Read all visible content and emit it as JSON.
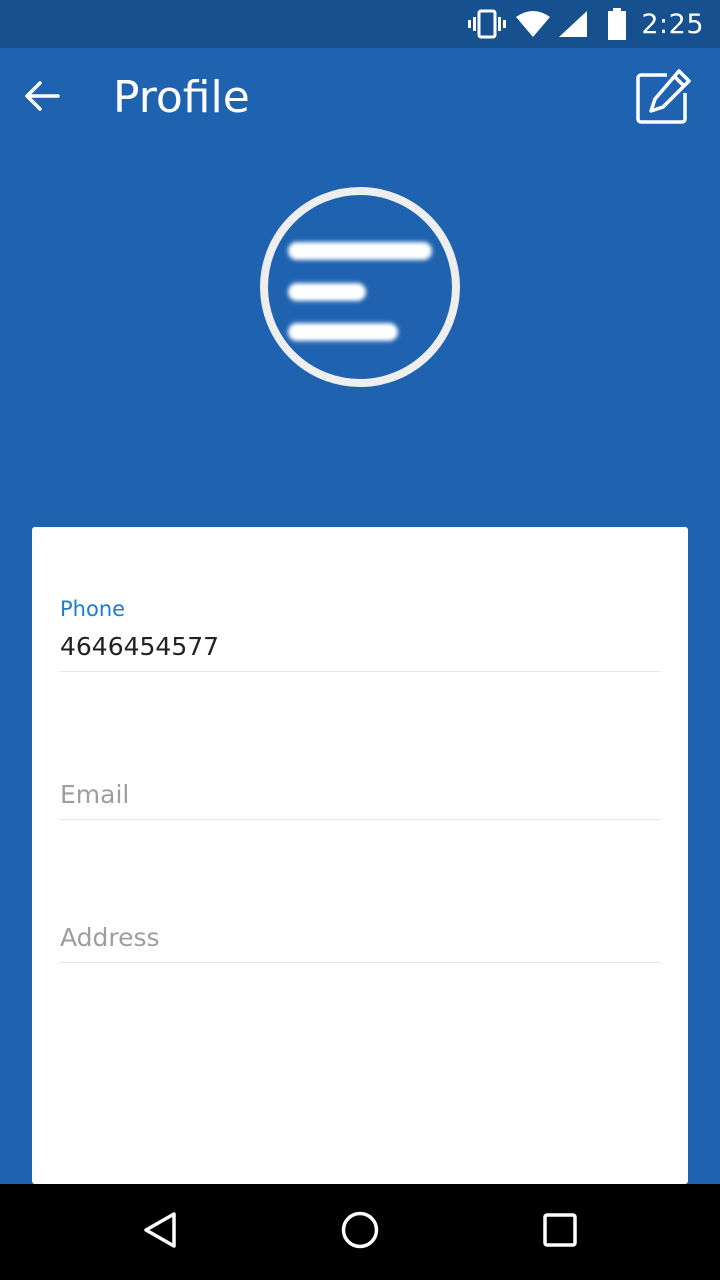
{
  "status_bar": {
    "time": "2:25",
    "icons": [
      "vibrate-icon",
      "wifi-icon",
      "cell-signal-icon",
      "battery-icon"
    ]
  },
  "app_bar": {
    "title": "Profile",
    "back_icon": "arrow-left-icon",
    "edit_icon": "edit-icon"
  },
  "profile": {
    "avatar_icon": "menu-lines-icon"
  },
  "form": {
    "phone": {
      "label": "Phone",
      "value": "4646454577"
    },
    "email": {
      "placeholder": "Email"
    },
    "address": {
      "placeholder": "Address"
    }
  },
  "nav_bar": {
    "icons": [
      "back-triangle-icon",
      "home-circle-icon",
      "recents-square-icon"
    ]
  },
  "colors": {
    "primary": "#1e62b0",
    "status_bar": "#16508f",
    "label_accent": "#1e7bd0"
  }
}
